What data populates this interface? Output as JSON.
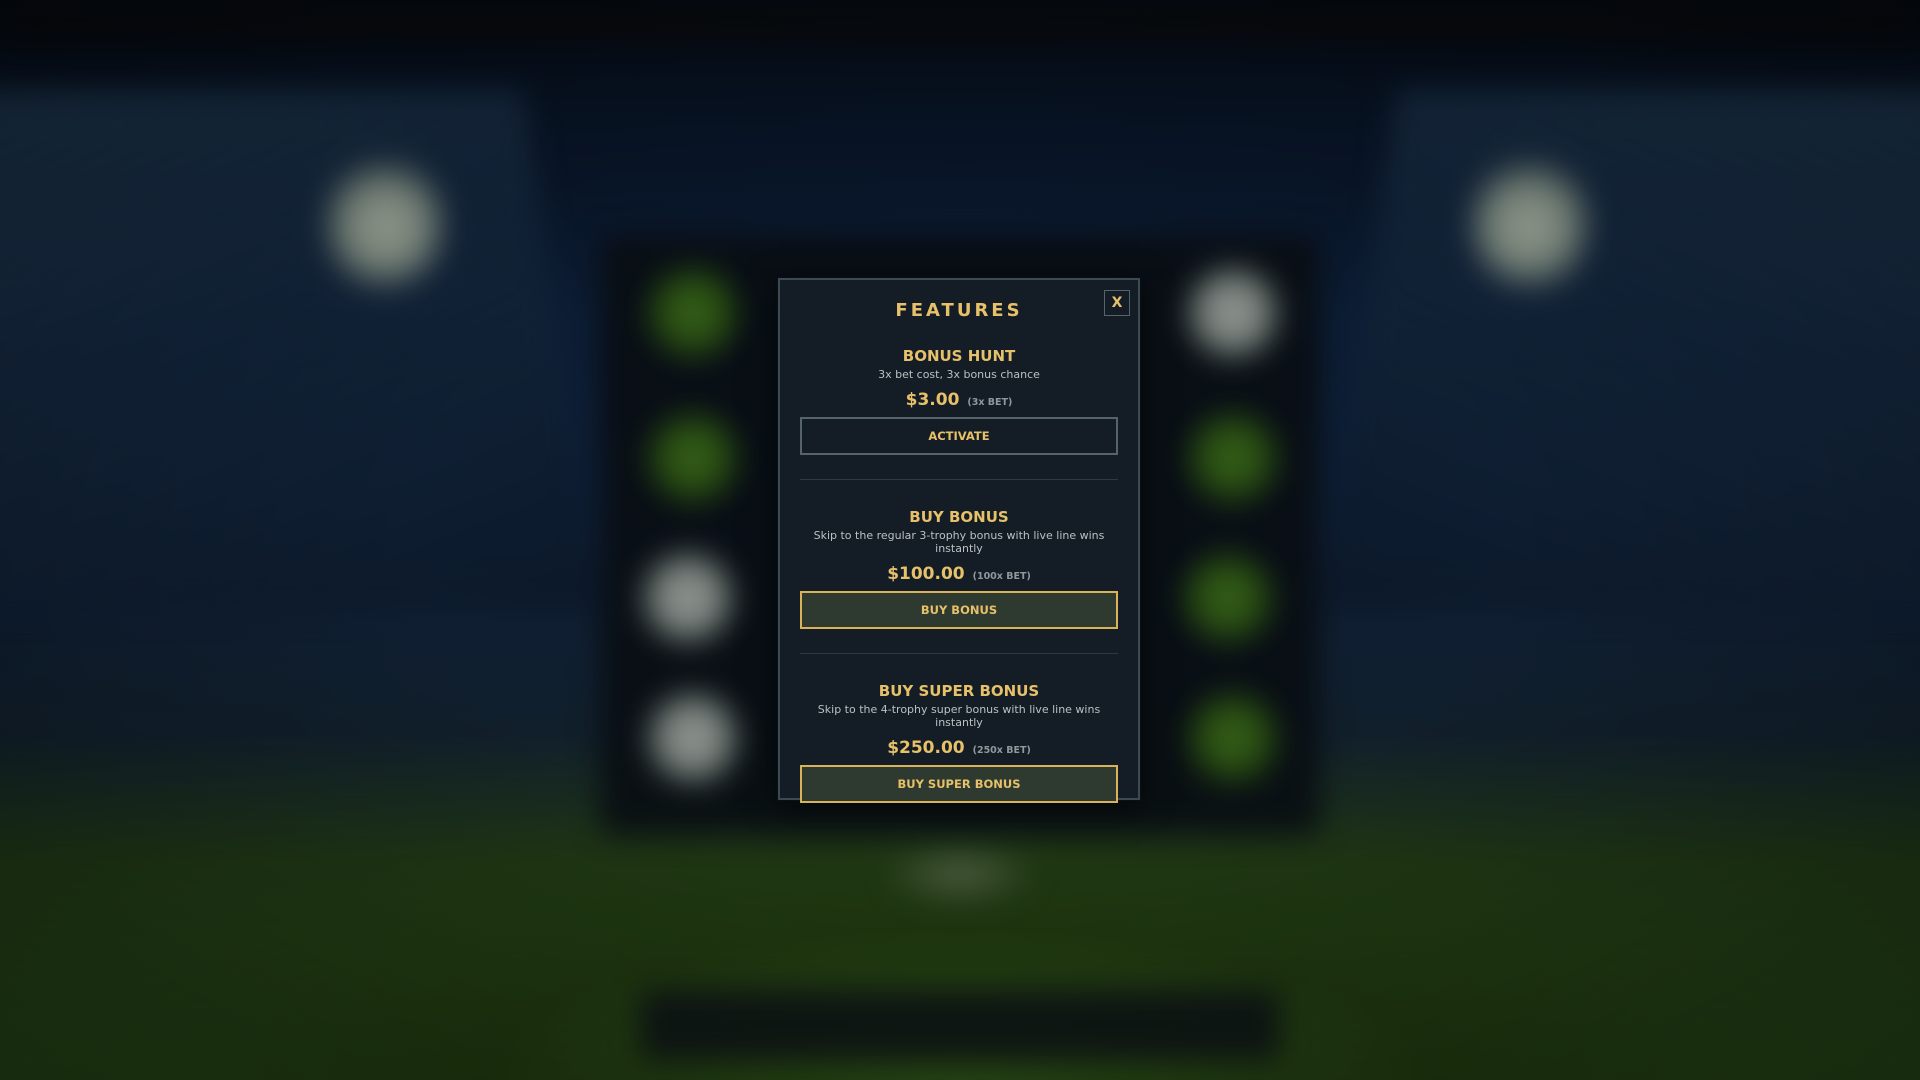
{
  "dialog": {
    "title": "FEATURES",
    "close_label": "X",
    "features": [
      {
        "name": "BONUS HUNT",
        "description": "3x bet cost, 3x bonus chance",
        "price": "$3.00",
        "multiplier": "(3x BET)",
        "button_label": "ACTIVATE",
        "button_style": "outline"
      },
      {
        "name": "BUY BONUS",
        "description": "Skip to the regular 3-trophy bonus with live line wins instantly",
        "price": "$100.00",
        "multiplier": "(100x BET)",
        "button_label": "BUY BONUS",
        "button_style": "gold"
      },
      {
        "name": "BUY SUPER BONUS",
        "description": "Skip to the 4-trophy super bonus with live line wins instantly",
        "price": "$250.00",
        "multiplier": "(250x BET)",
        "button_label": "BUY SUPER BONUS",
        "button_style": "gold"
      }
    ]
  },
  "colors": {
    "accent_gold": "#e7c06a",
    "dialog_bg": "#141d25",
    "dialog_border": "#3c4a52",
    "button_gold_border": "#d9b25a"
  }
}
